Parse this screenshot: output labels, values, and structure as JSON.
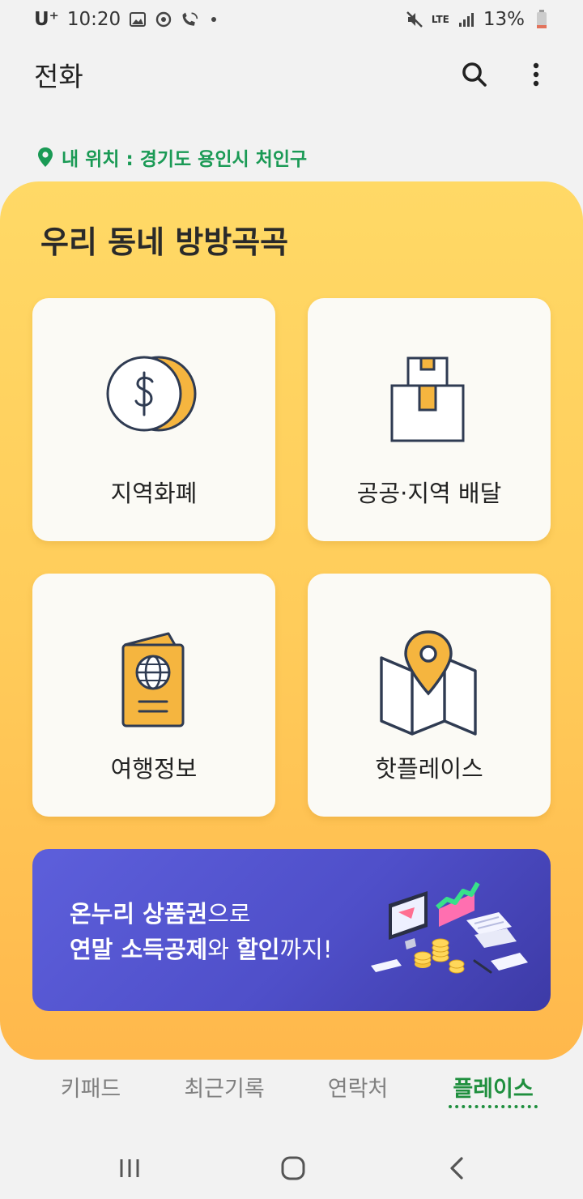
{
  "status_bar": {
    "carrier": "U⁺",
    "time": "10:20",
    "network": "LTE",
    "battery": "13%"
  },
  "app_bar": {
    "title": "전화"
  },
  "location": {
    "text": "내 위치 : 경기도 용인시 처인구"
  },
  "panel": {
    "title": "우리 동네 방방곡곡",
    "tiles": [
      {
        "label": "지역화폐",
        "icon": "coin-dollar-icon"
      },
      {
        "label": "공공·지역 배달",
        "icon": "delivery-box-icon"
      },
      {
        "label": "여행정보",
        "icon": "passport-icon"
      },
      {
        "label": "핫플레이스",
        "icon": "map-pin-icon"
      }
    ]
  },
  "banner": {
    "line1_bold": "온누리 상품권",
    "line1_rest": "으로",
    "line2_a": "연말 소득공제",
    "line2_b": "와 ",
    "line2_c": "할인",
    "line2_d": "까지!"
  },
  "tabs": [
    {
      "label": "키패드",
      "active": false
    },
    {
      "label": "최근기록",
      "active": false
    },
    {
      "label": "연락처",
      "active": false
    },
    {
      "label": "플레이스",
      "active": true
    }
  ],
  "colors": {
    "accent_green": "#1f8f3e",
    "location_green": "#1a9a55",
    "panel_yellow": "#ffd966",
    "panel_orange": "#ffb84c",
    "banner_purple": "#5d5fdb",
    "icon_orange": "#f5b53f",
    "icon_navy": "#2f3b52"
  }
}
